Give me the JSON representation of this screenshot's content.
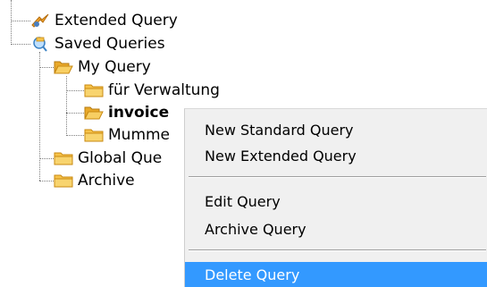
{
  "tree": {
    "extended_query": {
      "label": "Extended Query",
      "icon": "extended-query-icon"
    },
    "saved_queries": {
      "label": "Saved Queries",
      "icon": "saved-queries-icon"
    },
    "my_query": {
      "label": "My Query",
      "icon": "open-folder-icon"
    },
    "fuer_verwaltung": {
      "label": "für Verwaltung",
      "icon": "folder-icon"
    },
    "invoice": {
      "label": "invoice",
      "icon": "open-folder-icon"
    },
    "mumme": {
      "label": "Mumme",
      "icon": "folder-icon"
    },
    "global_queries": {
      "label": "Global Que",
      "icon": "folder-icon"
    },
    "archive": {
      "label": "Archive",
      "icon": "folder-icon"
    }
  },
  "context_menu": {
    "items": [
      {
        "label": "New Standard Query"
      },
      {
        "label": "New Extended Query"
      },
      {
        "label": "Edit Query"
      },
      {
        "label": "Archive Query"
      },
      {
        "label": "Delete Query",
        "highlighted": true
      }
    ]
  },
  "colors": {
    "menu_background": "#f0f0f0",
    "menu_highlight": "#3399ff",
    "folder_fill": "#f6c34a",
    "folder_outline": "#c98a12",
    "tree_connector": "#7f7f7f"
  }
}
